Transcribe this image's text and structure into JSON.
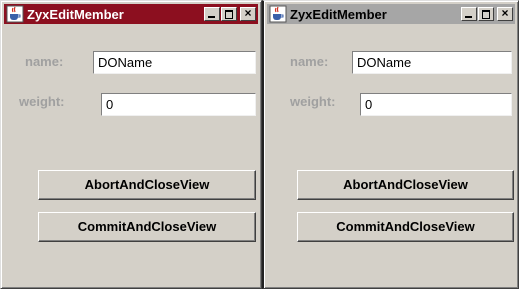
{
  "windows": [
    {
      "title": "ZyxEditMember",
      "name_label": "name:",
      "name_value": "DOName",
      "weight_label": "weight:",
      "weight_value": "0",
      "abort_label": "AbortAndCloseView",
      "commit_label": "CommitAndCloseView",
      "active": true
    },
    {
      "title": "ZyxEditMember",
      "name_label": "name:",
      "name_value": "DOName",
      "weight_label": "weight:",
      "weight_value": "0",
      "abort_label": "AbortAndCloseView",
      "commit_label": "CommitAndCloseView",
      "active": false
    }
  ],
  "colors": {
    "active_title": "#8c0f1f",
    "inactive_title": "#a6a6a6",
    "window_bg": "#d4d0c8",
    "label_text": "#a0a0a0"
  },
  "icons": [
    "java-cup-icon",
    "minimize-icon",
    "maximize-icon",
    "close-icon"
  ]
}
